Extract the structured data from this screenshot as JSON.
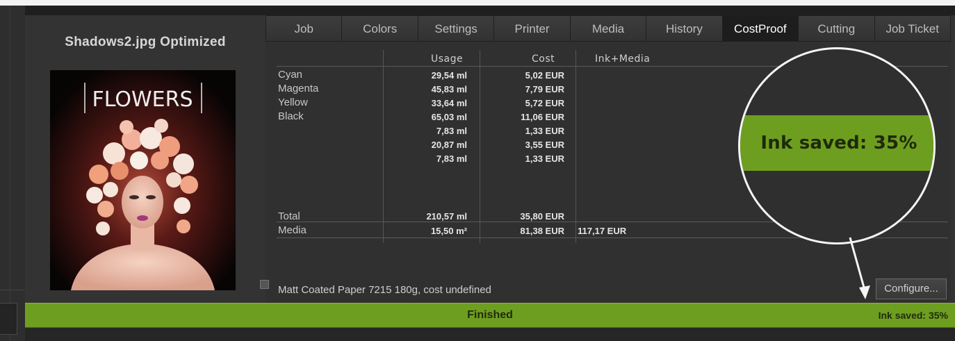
{
  "image": {
    "title": "Shadows2.jpg Optimized",
    "poster_title": "FLOWERS"
  },
  "tabs": [
    {
      "label": "Job"
    },
    {
      "label": "Colors"
    },
    {
      "label": "Settings"
    },
    {
      "label": "Printer"
    },
    {
      "label": "Media"
    },
    {
      "label": "History"
    },
    {
      "label": "CostProof",
      "active": true
    },
    {
      "label": "Cutting"
    },
    {
      "label": "Job Ticket"
    }
  ],
  "table": {
    "headers": {
      "usage": "Usage",
      "cost": "Cost",
      "ink_media": "Ink+Media"
    },
    "rows": [
      {
        "name": "Cyan",
        "usage": "29,54 ml",
        "cost": "5,02 EUR"
      },
      {
        "name": "Magenta",
        "usage": "45,83 ml",
        "cost": "7,79 EUR"
      },
      {
        "name": "Yellow",
        "usage": "33,64 ml",
        "cost": "5,72 EUR"
      },
      {
        "name": "Black",
        "usage": "65,03 ml",
        "cost": "11,06 EUR"
      },
      {
        "name": "",
        "usage": "7,83 ml",
        "cost": "1,33 EUR"
      },
      {
        "name": "",
        "usage": "20,87 ml",
        "cost": "3,55 EUR"
      },
      {
        "name": "",
        "usage": "7,83 ml",
        "cost": "1,33 EUR"
      }
    ],
    "total": {
      "name": "Total",
      "usage": "210,57 ml",
      "cost": "35,80 EUR"
    },
    "media": {
      "name": "Media",
      "usage": "15,50 m²",
      "cost": "81,38 EUR",
      "ink_media": "117,17 EUR"
    }
  },
  "paper_info": "Matt Coated Paper 7215 180g, cost undefined",
  "configure_label": "Configure...",
  "status": {
    "text": "Finished",
    "ink_saved": "Ink saved: 35%"
  },
  "callout": {
    "text": "Ink saved: 35%"
  },
  "colors": {
    "accent_green": "#6e9e1f",
    "active_tab": "#1d1d1d"
  }
}
